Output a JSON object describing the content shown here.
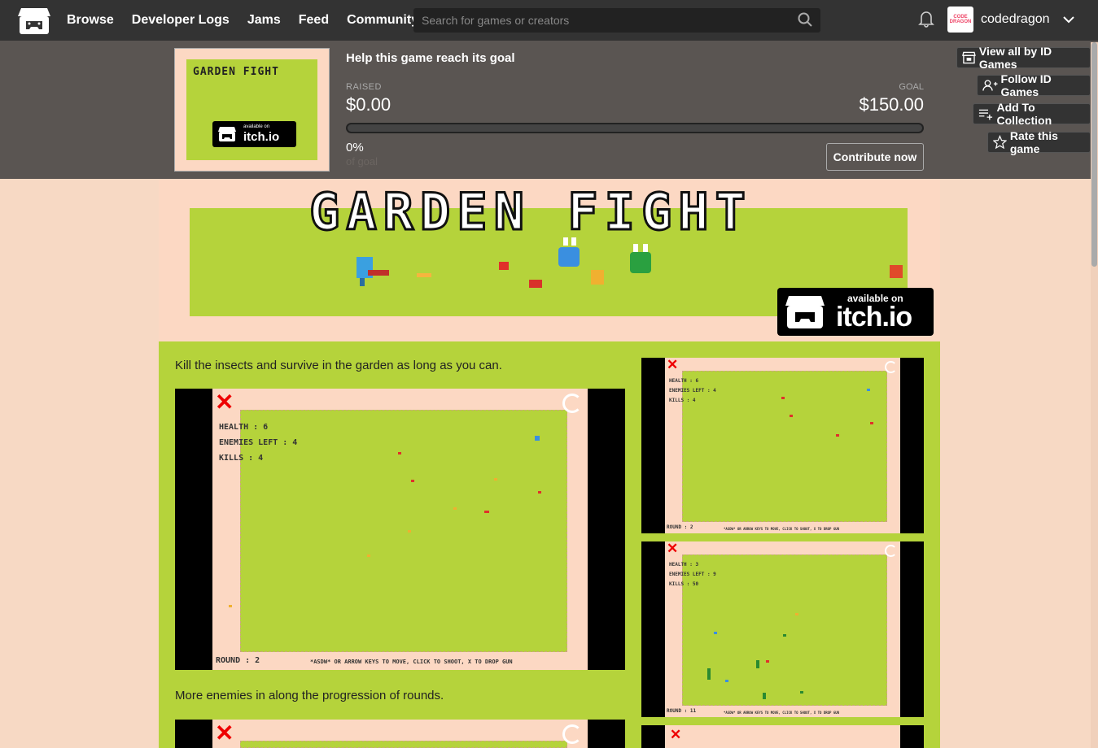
{
  "nav": {
    "items": [
      "Browse",
      "Developer Logs",
      "Jams",
      "Feed",
      "Community"
    ],
    "search_placeholder": "Search for games or creators",
    "username": "codedragon",
    "avatar_text": "CODE DRAGON"
  },
  "goal": {
    "heading": "Help this game reach its goal",
    "raised_label": "RAISED",
    "raised_value": "$0.00",
    "goal_label": "GOAL",
    "goal_value": "$150.00",
    "percent": "0%",
    "progress_fraction": 0,
    "of_goal": "of goal",
    "contribute": "Contribute now"
  },
  "side_buttons": {
    "view_all": "View all by ID Games",
    "follow": "Follow ID Games",
    "add_collection": "Add To Collection",
    "rate": "Rate this game"
  },
  "thumbnail": {
    "title": "GARDEN FIGHT",
    "badge_small": "available on",
    "badge_big": "itch.io"
  },
  "banner": {
    "title": "GARDEN FIGHT",
    "badge_small": "available on",
    "badge_big": "itch.io"
  },
  "body": {
    "desc1": "Kill the insects and survive in the garden as long as you can.",
    "desc2": "More enemies in along the progression of rounds."
  },
  "screenshots": {
    "main": {
      "health": "HEALTH : 6",
      "enemies": "ENEMIES LEFT : 4",
      "kills": "KILLS : 4",
      "round": "ROUND : 2",
      "footer": "*ASDW* OR ARROW KEYS TO MOVE, CLICK TO SHOOT, X TO DROP GUN"
    },
    "side1": {
      "health": "HEALTH : 6",
      "enemies": "ENEMIES LEFT : 4",
      "kills": "KILLS : 4",
      "round": "ROUND : 2",
      "footer": "*ASDW* OR ARROW KEYS TO MOVE, CLICK TO SHOOT, X TO DROP GUN"
    },
    "side2": {
      "health": "HEALTH : 3",
      "enemies": "ENEMIES LEFT : 9",
      "kills": "KILLS : 50",
      "round": "ROUND : 11",
      "footer": "*ASDW* OR ARROW KEYS TO MOVE, CLICK TO SHOOT, X TO DROP GUN"
    }
  },
  "colors": {
    "topbar": "#333333",
    "goalbar": "#5a5552",
    "page_bg": "#fcd8c3",
    "grass": "#b5d33b",
    "accent": "#fa5c5c"
  }
}
